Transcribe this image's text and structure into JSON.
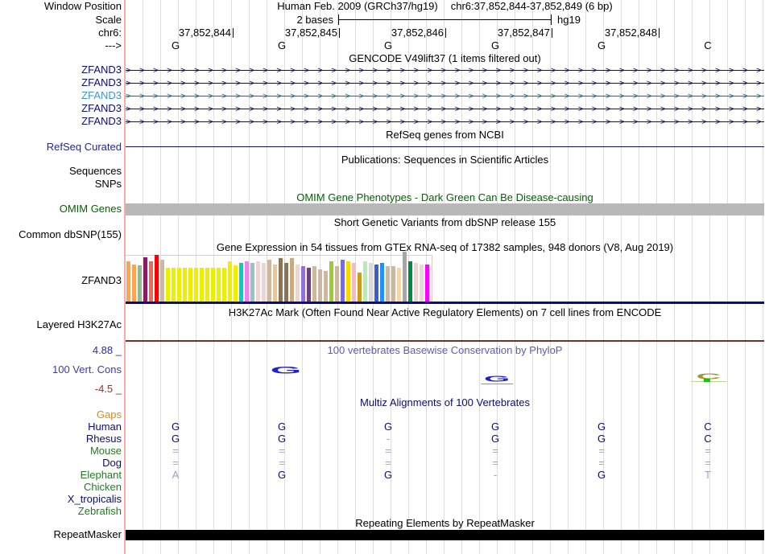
{
  "colors": {
    "navy": "#0c0c78",
    "grid_line": "#dcdcee",
    "guide_pink": "#f9aaaa",
    "omim_green": "#006400",
    "gray_bar": "#b8b8b8",
    "maroon_line": "#7d2b2b",
    "gtex_baseline": "#0c0c78",
    "phylop_blue": "#2222cc",
    "phylop_olive": "#9a9a2e",
    "muted_align": "#99a2c9"
  },
  "header": {
    "window_position_label": "Window Position",
    "assembly_title": "Human Feb. 2009 (GRCh37/hg19)",
    "position_title": "chr6:37,852,844-37,852,849 (6 bp)",
    "scale_label": "Scale",
    "scale_value": "2 bases",
    "scale_genome": "hg19",
    "chrom_label": "chr6:",
    "strand_label": "--->",
    "positions": [
      "37,852,844",
      "37,852,845",
      "37,852,846",
      "37,852,847",
      "37,852,848"
    ],
    "bases": [
      "G",
      "G",
      "G",
      "G",
      "G",
      "C"
    ]
  },
  "tracks": {
    "gencode": {
      "title": "GENCODE V49lift37 (1 items filtered out)",
      "genes": [
        {
          "name": "ZFAND3",
          "label_color": "#0c0c78",
          "arrow_color": "#0c0c78"
        },
        {
          "name": "ZFAND3",
          "label_color": "#0c0c78",
          "arrow_color": "#0c0c78"
        },
        {
          "name": "ZFAND3",
          "label_color": "#4293c9",
          "arrow_color": "#0d6e93"
        },
        {
          "name": "ZFAND3",
          "label_color": "#0c0c78",
          "arrow_color": "#0c0c78"
        },
        {
          "name": "ZFAND3",
          "label_color": "#0c0c78",
          "arrow_color": "#0c0c78"
        }
      ]
    },
    "refseq": {
      "title": "RefSeq genes from NCBI",
      "label": "RefSeq Curated",
      "label_color": "#2626a0"
    },
    "publications": {
      "title": "Publications: Sequences in Scientific Articles",
      "sequences_label": "Sequences",
      "snps_label": "SNPs"
    },
    "omim": {
      "title": "OMIM Gene Phenotypes - Dark Green Can Be Disease-causing",
      "label": "OMIM Genes"
    },
    "dbsnp": {
      "title": "Short Genetic Variants from dbSNP release 155",
      "label": "Common dbSNP(155)"
    },
    "gtex": {
      "title": "Gene Expression in 54 tissues from GTEx RNA-seq of 17382 samples, 948 donors (V8, Aug 2019)",
      "label": "ZFAND3"
    },
    "h3k27ac": {
      "title": "H3K27Ac Mark (Often Found Near Active Regulatory Elements) on 7 cell lines from ENCODE",
      "label": "Layered H3K27Ac"
    },
    "phylop": {
      "title": "100 vertebrates Basewise Conservation by PhyloP",
      "label": "100 Vert. Cons",
      "max_label": "4.88 _",
      "min_label": "-4.5 _"
    },
    "multiz": {
      "title": "Multiz Alignments of 100 Vertebrates",
      "rows": [
        {
          "name": "Gaps",
          "color": "#e8860b",
          "cells": []
        },
        {
          "name": "Human",
          "color": "#0c0c78",
          "cells": [
            {
              "t": "G",
              "m": false
            },
            {
              "t": "G",
              "m": false
            },
            {
              "t": "G",
              "m": false
            },
            {
              "t": "G",
              "m": false
            },
            {
              "t": "G",
              "m": false
            },
            {
              "t": "C",
              "m": false
            }
          ]
        },
        {
          "name": "Rhesus",
          "color": "#0c0c78",
          "cells": [
            {
              "t": "G",
              "m": false
            },
            {
              "t": "G",
              "m": false
            },
            {
              "t": "-",
              "m": true
            },
            {
              "t": "G",
              "m": false
            },
            {
              "t": "G",
              "m": false
            },
            {
              "t": "C",
              "m": false
            }
          ]
        },
        {
          "name": "Mouse",
          "color": "#1f7d1f",
          "cells": [
            {
              "t": "=",
              "m": true
            },
            {
              "t": "=",
              "m": true
            },
            {
              "t": "=",
              "m": true
            },
            {
              "t": "=",
              "m": true
            },
            {
              "t": "=",
              "m": true
            },
            {
              "t": "=",
              "m": true
            }
          ]
        },
        {
          "name": "Dog",
          "color": "#0c0c78",
          "cells": [
            {
              "t": "=",
              "m": true
            },
            {
              "t": "=",
              "m": true
            },
            {
              "t": "=",
              "m": true
            },
            {
              "t": "=",
              "m": true
            },
            {
              "t": "=",
              "m": true
            },
            {
              "t": "=",
              "m": true
            }
          ]
        },
        {
          "name": "Elephant",
          "color": "#1f7d1f",
          "cells": [
            {
              "t": "A",
              "m": true
            },
            {
              "t": "G",
              "m": false
            },
            {
              "t": "G",
              "m": false
            },
            {
              "t": "-",
              "m": true
            },
            {
              "t": "G",
              "m": false
            },
            {
              "t": "T",
              "m": true
            }
          ]
        },
        {
          "name": "Chicken",
          "color": "#1f7d1f",
          "cells": []
        },
        {
          "name": "X_tropicalis",
          "color": "#0c0c78",
          "cells": []
        },
        {
          "name": "Zebrafish",
          "color": "#1f7d1f",
          "cells": []
        }
      ]
    },
    "repeatmasker": {
      "title": "Repeating Elements by RepeatMasker",
      "label": "RepeatMasker"
    }
  },
  "chart_data": {
    "type": "bar",
    "title": "Gene Expression in 54 tissues from GTEx RNA-seq of 17382 samples, 948 donors (V8, Aug 2019)",
    "gene": "ZFAND3",
    "bars": [
      {
        "color": "#FFA54F",
        "h": 50
      },
      {
        "color": "#FFA54F",
        "h": 46
      },
      {
        "color": "#8FBC8F",
        "h": 45
      },
      {
        "color": "#8B1C62",
        "h": 55
      },
      {
        "color": "#EE6A50",
        "h": 50
      },
      {
        "color": "#FF0000",
        "h": 58
      },
      {
        "color": "#CDB79E",
        "h": 52
      },
      {
        "color": "#EEEE00",
        "h": 42
      },
      {
        "color": "#EEEE00",
        "h": 42
      },
      {
        "color": "#EEEE00",
        "h": 42
      },
      {
        "color": "#EEEE00",
        "h": 42
      },
      {
        "color": "#EEEE00",
        "h": 42
      },
      {
        "color": "#EEEE00",
        "h": 42
      },
      {
        "color": "#EEEE00",
        "h": 42
      },
      {
        "color": "#EEEE00",
        "h": 42
      },
      {
        "color": "#EEEE00",
        "h": 42
      },
      {
        "color": "#EEEE00",
        "h": 42
      },
      {
        "color": "#EEEE00",
        "h": 42
      },
      {
        "color": "#EEEE00",
        "h": 50
      },
      {
        "color": "#EEEE00",
        "h": 45
      },
      {
        "color": "#00CDCD",
        "h": 48
      },
      {
        "color": "#EE82EE",
        "h": 50
      },
      {
        "color": "#9AC0CD",
        "h": 48
      },
      {
        "color": "#EED5D2",
        "h": 50
      },
      {
        "color": "#EED5D2",
        "h": 48
      },
      {
        "color": "#CDB79E",
        "h": 52
      },
      {
        "color": "#EEC591",
        "h": 46
      },
      {
        "color": "#8B7355",
        "h": 54
      },
      {
        "color": "#8B7355",
        "h": 48
      },
      {
        "color": "#CDAA7D",
        "h": 54
      },
      {
        "color": "#EED5D2",
        "h": 46
      },
      {
        "color": "#9370DB",
        "h": 44
      },
      {
        "color": "#7A378B",
        "h": 42
      },
      {
        "color": "#CDB79E",
        "h": 44
      },
      {
        "color": "#CDB79E",
        "h": 40
      },
      {
        "color": "#CDB79E",
        "h": 38
      },
      {
        "color": "#9ACD32",
        "h": 50
      },
      {
        "color": "#CDB79E",
        "h": 44
      },
      {
        "color": "#7A67EE",
        "h": 52
      },
      {
        "color": "#FFD700",
        "h": 50
      },
      {
        "color": "#FFB6C1",
        "h": 48
      },
      {
        "color": "#CD9B1D",
        "h": 36
      },
      {
        "color": "#B4EEB4",
        "h": 50
      },
      {
        "color": "#D9D9D9",
        "h": 48
      },
      {
        "color": "#3A5FCD",
        "h": 46
      },
      {
        "color": "#1E90FF",
        "h": 48
      },
      {
        "color": "#CDB79E",
        "h": 44
      },
      {
        "color": "#CDB79E",
        "h": 44
      },
      {
        "color": "#FFD39B",
        "h": 42
      },
      {
        "color": "#A6A6A6",
        "h": 62
      },
      {
        "color": "#008B45",
        "h": 50
      },
      {
        "color": "#EED5D2",
        "h": 48
      },
      {
        "color": "#EED5D2",
        "h": 46
      },
      {
        "color": "#FF00FF",
        "h": 46
      }
    ]
  }
}
